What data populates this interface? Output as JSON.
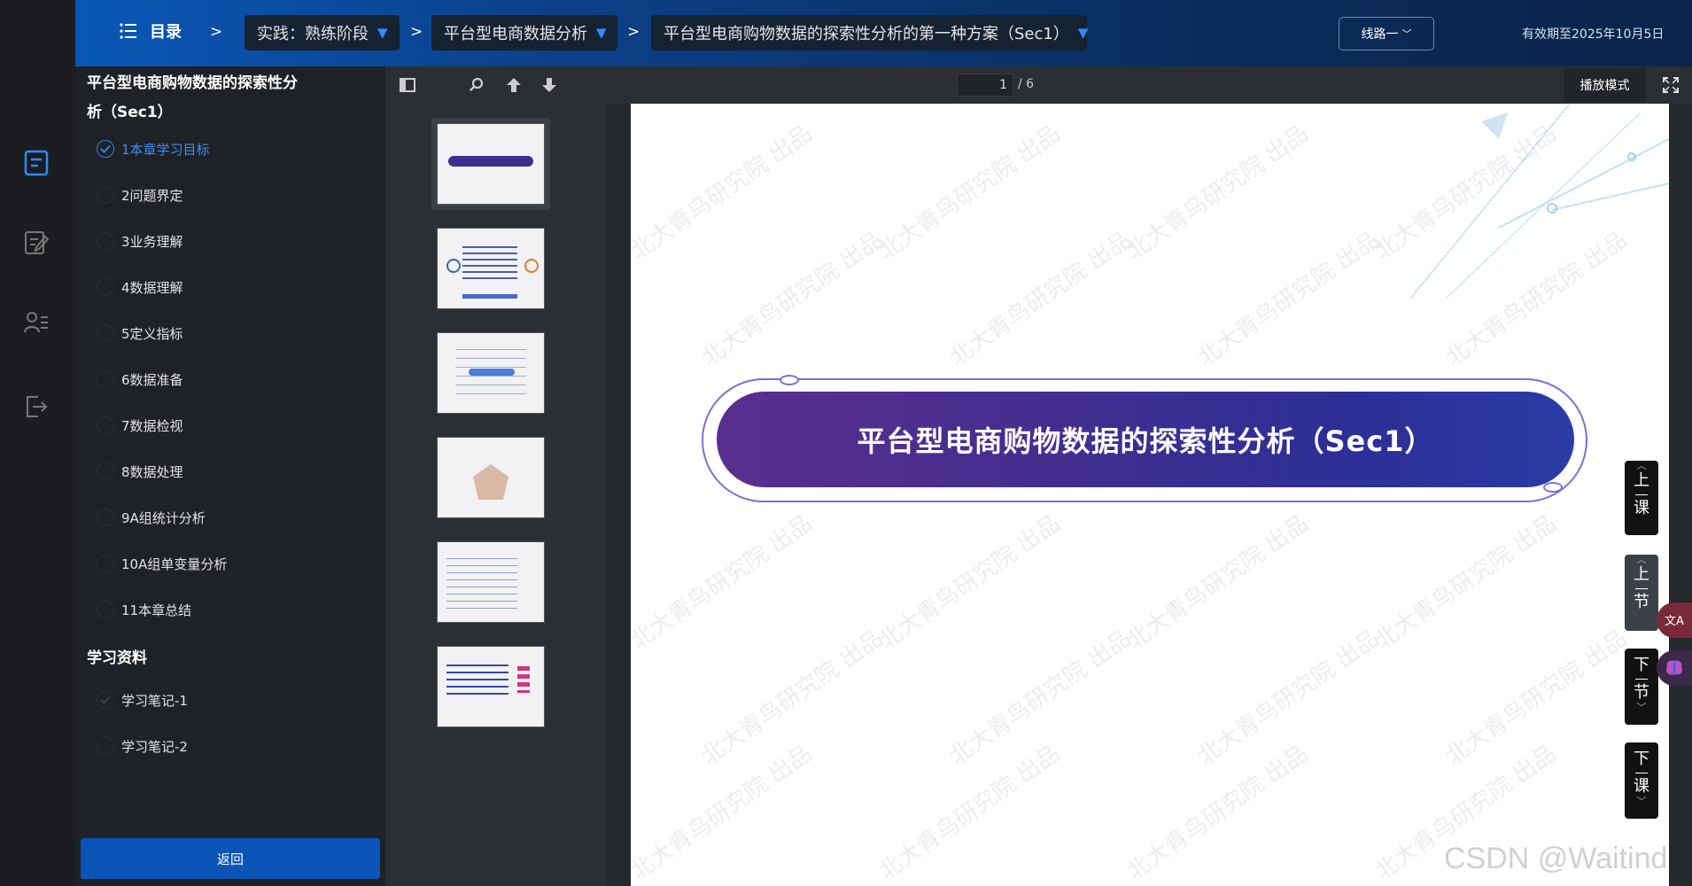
{
  "header": {
    "menu_label": "目录",
    "separator": ">",
    "breadcrumbs": [
      {
        "label": "实践：熟练阶段"
      },
      {
        "label": "平台型电商数据分析"
      },
      {
        "label": "平台型电商购物数据的探索性分析的第一种方案（Sec1）"
      }
    ],
    "line_button": "线路一",
    "valid_until": "有效期至2025年10月5日"
  },
  "catalog": {
    "title": "平台型电商购物数据的探索性分析（Sec1）",
    "items": [
      {
        "label": "1本章学习目标",
        "active": true
      },
      {
        "label": "2问题界定"
      },
      {
        "label": "3业务理解"
      },
      {
        "label": "4数据理解"
      },
      {
        "label": "5定义指标"
      },
      {
        "label": "6数据准备"
      },
      {
        "label": "7数据检视"
      },
      {
        "label": "8数据处理"
      },
      {
        "label": "9A组统计分析"
      },
      {
        "label": "10A组单变量分析"
      },
      {
        "label": "11本章总结"
      }
    ],
    "materials_title": "学习资料",
    "materials": [
      {
        "label": "学习笔记-1"
      },
      {
        "label": "学习笔记-2"
      }
    ],
    "back_button": "返回"
  },
  "viewer": {
    "page_current": "1",
    "page_total": "/ 6",
    "play_mode": "播放模式",
    "thumbnail_count": 6
  },
  "slide": {
    "title": "平台型电商购物数据的探索性分析（Sec1）",
    "watermark": "北大青鸟研究院 出品"
  },
  "side_nav": {
    "prev_lesson": [
      "上",
      "课"
    ],
    "prev_section": [
      "上",
      "节"
    ],
    "next_section": [
      "下",
      "节"
    ],
    "next_lesson": [
      "下",
      "课"
    ]
  },
  "corner_watermark": "CSDN @Waitind",
  "colors": {
    "accent": "#2f7fe8",
    "topbar": "#0b4088",
    "button": "#0b55b8",
    "banner": "#3f2e8f"
  }
}
